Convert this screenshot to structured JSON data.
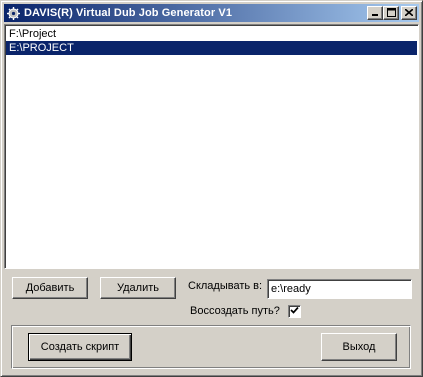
{
  "window": {
    "title": "DAVIS(R) Virtual Dub Job Generator V1",
    "minimize_label": "_",
    "maximize_label": "□",
    "close_label": "✕"
  },
  "list": {
    "items": [
      {
        "label": "F:\\Project",
        "selected": false
      },
      {
        "label": "E:\\PROJECT",
        "selected": true
      }
    ]
  },
  "controls": {
    "add_label": "Добавить",
    "remove_label": "Удалить",
    "output_label": "Складывать в:",
    "output_value": "e:\\ready",
    "recreate_label": "Воссоздать путь?",
    "recreate_checked": true
  },
  "footer": {
    "create_label": "Создать скрипт",
    "exit_label": "Выход"
  },
  "colors": {
    "title_gradient_start": "#0a246a",
    "title_gradient_end": "#a6caf0",
    "selection": "#0a246a",
    "face": "#d4d0c8"
  },
  "icons": [
    "app-gear-icon",
    "minimize-icon",
    "maximize-icon",
    "close-icon",
    "checkmark-icon"
  ]
}
